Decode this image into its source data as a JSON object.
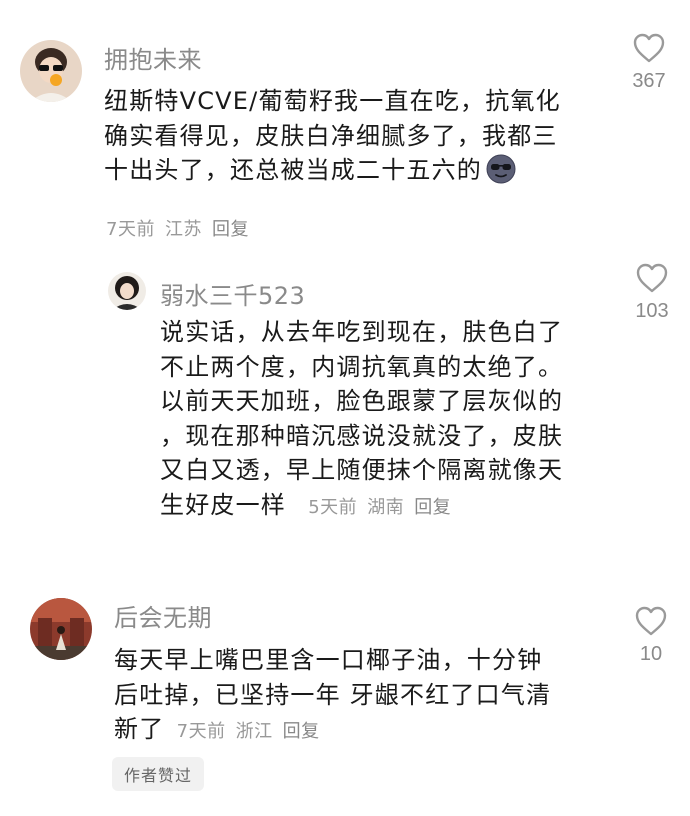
{
  "comments": [
    {
      "username": "拥抱未来",
      "text_lines": [
        "纽斯特VCVE/葡萄籽我一直在吃，抗氧化",
        "确实看得见，皮肤白净细腻多了，我都三",
        "十出头了，还总被当成二十五六的"
      ],
      "emoji": "sunglasses-face-emoji",
      "time": "7天前",
      "location": "江苏",
      "reply_label": "回复",
      "likes": "367"
    },
    {
      "username": "弱水三千523",
      "text_lines": [
        "说实话，从去年吃到现在，肤色白了",
        "不止两个度，内调抗氧真的太绝了。",
        "以前天天加班，脸色跟蒙了层灰似的",
        "，现在那种暗沉感说没就没了，皮肤",
        "又白又透，早上随便抹个隔离就像天",
        "生好皮一样"
      ],
      "time": "5天前",
      "location": "湖南",
      "reply_label": "回复",
      "likes": "103"
    },
    {
      "username": "后会无期",
      "text_lines": [
        "每天早上嘴巴里含一口椰子油，十分钟",
        "后吐掉，已坚持一年 牙龈不红了口气清",
        "新了"
      ],
      "time": "7天前",
      "location": "浙江",
      "reply_label": "回复",
      "likes": "10",
      "badge": "作者赞过"
    }
  ],
  "colors": {
    "text": "#1a1a1a",
    "secondary": "#8a8a8a",
    "badge_bg": "#f1f1f1"
  }
}
